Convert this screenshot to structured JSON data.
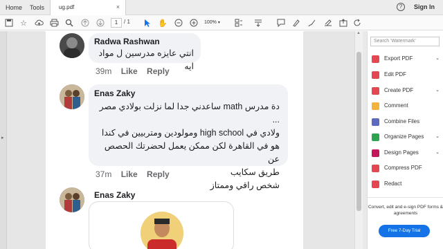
{
  "menubar": {
    "home": "Home",
    "tools": "Tools",
    "tab_title": "ug.pdf",
    "tab_close": "×",
    "help": "?",
    "sign_in": "Sign In"
  },
  "toolbar": {
    "page_current": "1",
    "page_total": "/ 1",
    "zoom": "100%"
  },
  "comments": [
    {
      "name": "Radwa Rashwan",
      "text": "انتي عايزه مدرسين ل مواد ايه",
      "time": "39m",
      "like": "Like",
      "reply": "Reply"
    },
    {
      "name": "Enas Zaky",
      "lines": [
        "دة مدرس math ساعدني جدا لما نزلت بولادي مصر ...",
        "ولادي في high school ومولودين ومتربيين في كندا",
        "هو في القاهرة لكن ممكن يعمل لحضرتك الحصص عن",
        "طريق سكايب",
        "شخص راقي وممتاز"
      ],
      "time": "37m",
      "like": "Like",
      "reply": "Reply"
    },
    {
      "name": "Enas Zaky"
    }
  ],
  "right_panel": {
    "search_placeholder": "Search 'Watermark'",
    "items": [
      {
        "label": "Export PDF",
        "color": "#e34850",
        "expand": "⌄"
      },
      {
        "label": "Edit PDF",
        "color": "#e34850",
        "expand": ""
      },
      {
        "label": "Create PDF",
        "color": "#e34850",
        "expand": "⌄"
      },
      {
        "label": "Comment",
        "color": "#f3b33d",
        "expand": ""
      },
      {
        "label": "Combine Files",
        "color": "#5c6bc0",
        "expand": ""
      },
      {
        "label": "Organize Pages",
        "color": "#2da44e",
        "expand": "⌄"
      },
      {
        "label": "Design Pages",
        "color": "#c2185b",
        "expand": "⌄"
      },
      {
        "label": "Compress PDF",
        "color": "#e34850",
        "expand": ""
      },
      {
        "label": "Redact",
        "color": "#e34850",
        "expand": ""
      }
    ],
    "promo": "Convert, edit and e-sign PDF forms & agreements",
    "trial_button": "Free 7-Day Trial"
  }
}
